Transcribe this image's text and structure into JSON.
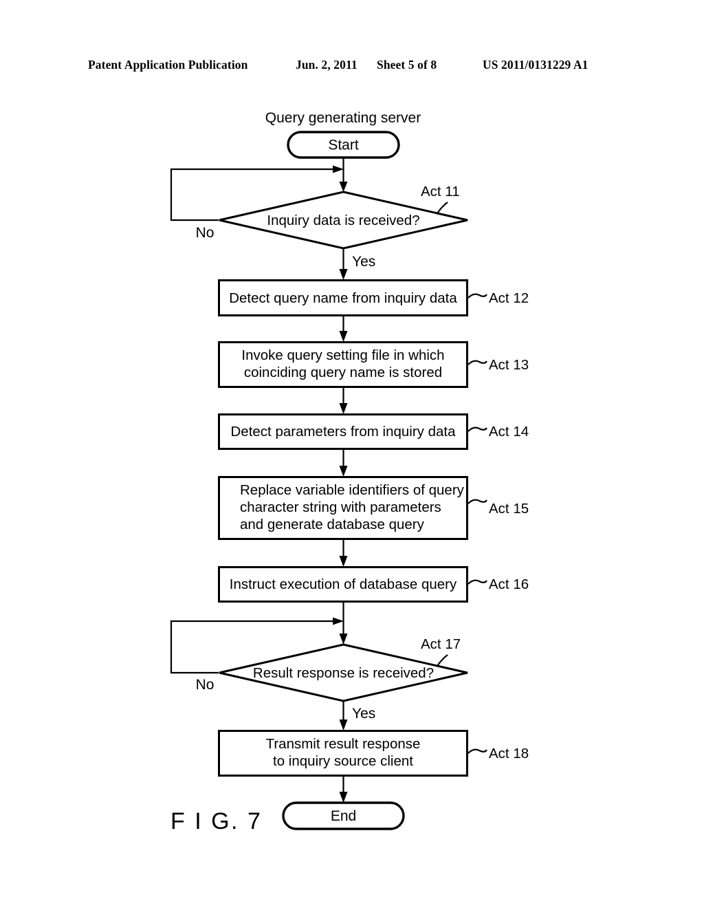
{
  "header": {
    "publication": "Patent Application Publication",
    "date": "Jun. 2, 2011",
    "sheet": "Sheet 5 of 8",
    "doc_number": "US 2011/0131229 A1"
  },
  "figure": {
    "label": "F I G. 7",
    "diagram_title": "Query generating server"
  },
  "flowchart": {
    "type": "flowchart",
    "start_label": "Start",
    "end_label": "End",
    "yes_label": "Yes",
    "no_label": "No",
    "nodes": [
      {
        "id": "start",
        "kind": "terminal",
        "text": "Start"
      },
      {
        "id": "act11",
        "kind": "decision",
        "text": "Inquiry data is received?",
        "act": "Act 11",
        "yes": "Yes",
        "no": "No"
      },
      {
        "id": "act12",
        "kind": "process",
        "lines": [
          "Detect query name from inquiry data"
        ],
        "act": "Act 12",
        "align": "center"
      },
      {
        "id": "act13",
        "kind": "process",
        "lines": [
          "Invoke query setting file in which",
          "coinciding query name is stored"
        ],
        "act": "Act 13",
        "align": "center"
      },
      {
        "id": "act14",
        "kind": "process",
        "lines": [
          "Detect parameters from inquiry data"
        ],
        "act": "Act 14",
        "align": "center"
      },
      {
        "id": "act15",
        "kind": "process",
        "lines": [
          "Replace variable identifiers of query",
          "character string with parameters",
          "and generate database query"
        ],
        "act": "Act 15",
        "align": "left"
      },
      {
        "id": "act16",
        "kind": "process",
        "lines": [
          "Instruct execution of database query"
        ],
        "act": "Act 16",
        "align": "center"
      },
      {
        "id": "act17",
        "kind": "decision",
        "text": "Result response is received?",
        "act": "Act 17",
        "yes": "Yes",
        "no": "No"
      },
      {
        "id": "act18",
        "kind": "process",
        "lines": [
          "Transmit result response",
          "to inquiry source client"
        ],
        "act": "Act 18",
        "align": "center"
      },
      {
        "id": "end",
        "kind": "terminal",
        "text": "End"
      }
    ]
  },
  "colors": {
    "ink": "#000000",
    "paper": "#ffffff"
  }
}
